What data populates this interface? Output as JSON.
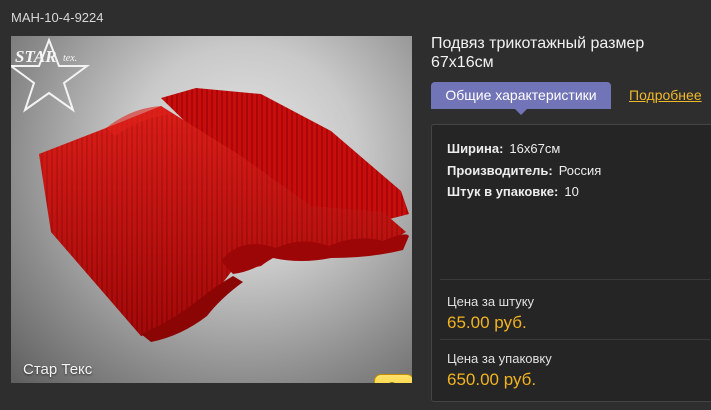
{
  "product": {
    "sku": "МАН-10-4-9224",
    "title": "Подвяз трикотажный размер 67х16см",
    "logo_text": "Стар Текс",
    "logo_mark": "STAR tex"
  },
  "tabs": {
    "active_label": "Общие характеристики",
    "more_label": "Подробнее"
  },
  "specs": [
    {
      "label": "Ширина:",
      "value": "16х67см"
    },
    {
      "label": "Производитель:",
      "value": "Россия"
    },
    {
      "label": "Штук в упаковке:",
      "value": "10"
    }
  ],
  "prices": {
    "unit_label": "Цена за штуку",
    "unit_value": "65.00 руб.",
    "pack_label": "Цена за упаковку",
    "pack_value": "650.00 руб."
  },
  "colors": {
    "accent_tab": "#7274b8",
    "price": "#f2b320",
    "link": "#f0b92a"
  },
  "icons": {
    "zoom": "magnifier-icon"
  }
}
